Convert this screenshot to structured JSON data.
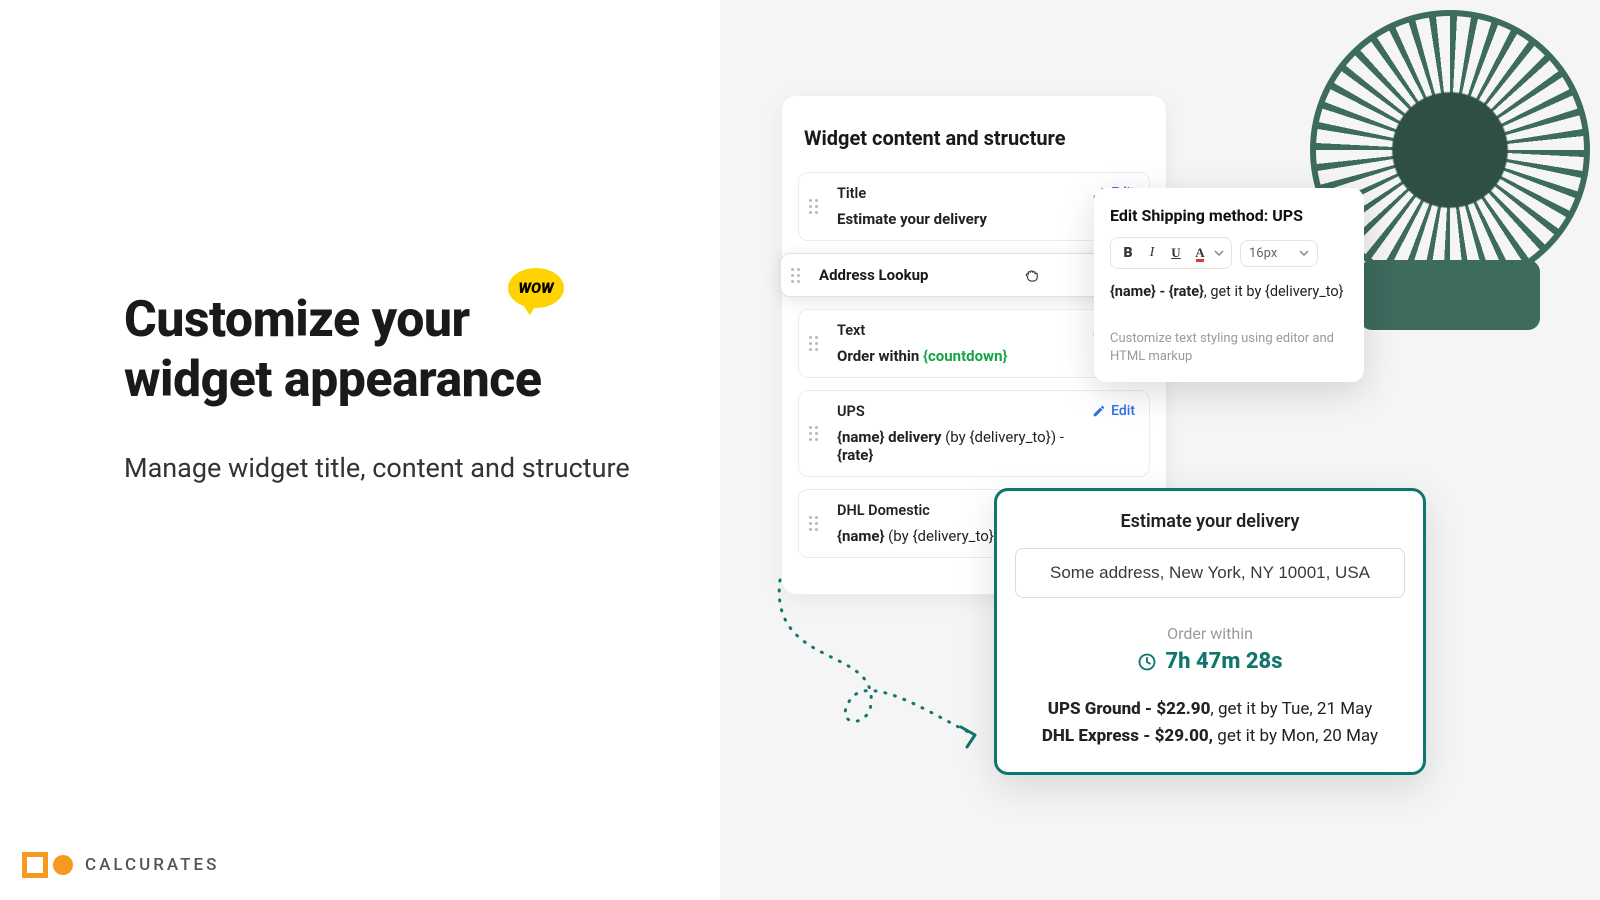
{
  "hero": {
    "title_line1": "Customize your",
    "title_line2": "widget appearance",
    "subtitle": "Manage widget title, content and structure",
    "wow": "WOW"
  },
  "brand": {
    "name": "CALCURATES"
  },
  "widget_card": {
    "title": "Widget content and structure",
    "edit_label": "Edit",
    "blocks": [
      {
        "label": "Title",
        "content_bold": "Estimate your delivery",
        "content_soft": "",
        "var_green": ""
      },
      {
        "label": "Address Lookup"
      },
      {
        "label": "Text",
        "content_bold": "Order within ",
        "var_green": "{countdown}",
        "content_soft": ""
      },
      {
        "label": "UPS",
        "content_bold": "{name} delivery ",
        "content_soft": "(by {delivery_to}) - ",
        "content_bold_tail": "{rate}"
      },
      {
        "label": "DHL Domestic",
        "content_bold": "{name} ",
        "content_soft": "(by {delivery_to})",
        "content_bold_tail": ""
      }
    ]
  },
  "editor": {
    "title": "Edit Shipping method: UPS",
    "font_size": "16px",
    "body_bold": "{name} - {rate}",
    "body_soft_1": ", get it by ",
    "body_soft_2": "{delivery_to}",
    "help": "Customize text styling using editor and HTML markup"
  },
  "preview": {
    "title": "Estimate your delivery",
    "address": "Some address, New York, NY 10001, USA",
    "order_within_label": "Order within",
    "countdown": "7h 47m 28s",
    "rates": [
      {
        "bold": "UPS Ground - $22.90",
        "rest": ", get it by Tue, 21 May"
      },
      {
        "bold": "DHL Express - $29.00,",
        "rest": " get it by Mon, 20 May"
      }
    ]
  },
  "colors": {
    "accent_green": "#0f766e",
    "link_blue": "#2f6fe8",
    "wow_yellow": "#ffd300",
    "brand_orange": "#f39a1f"
  }
}
